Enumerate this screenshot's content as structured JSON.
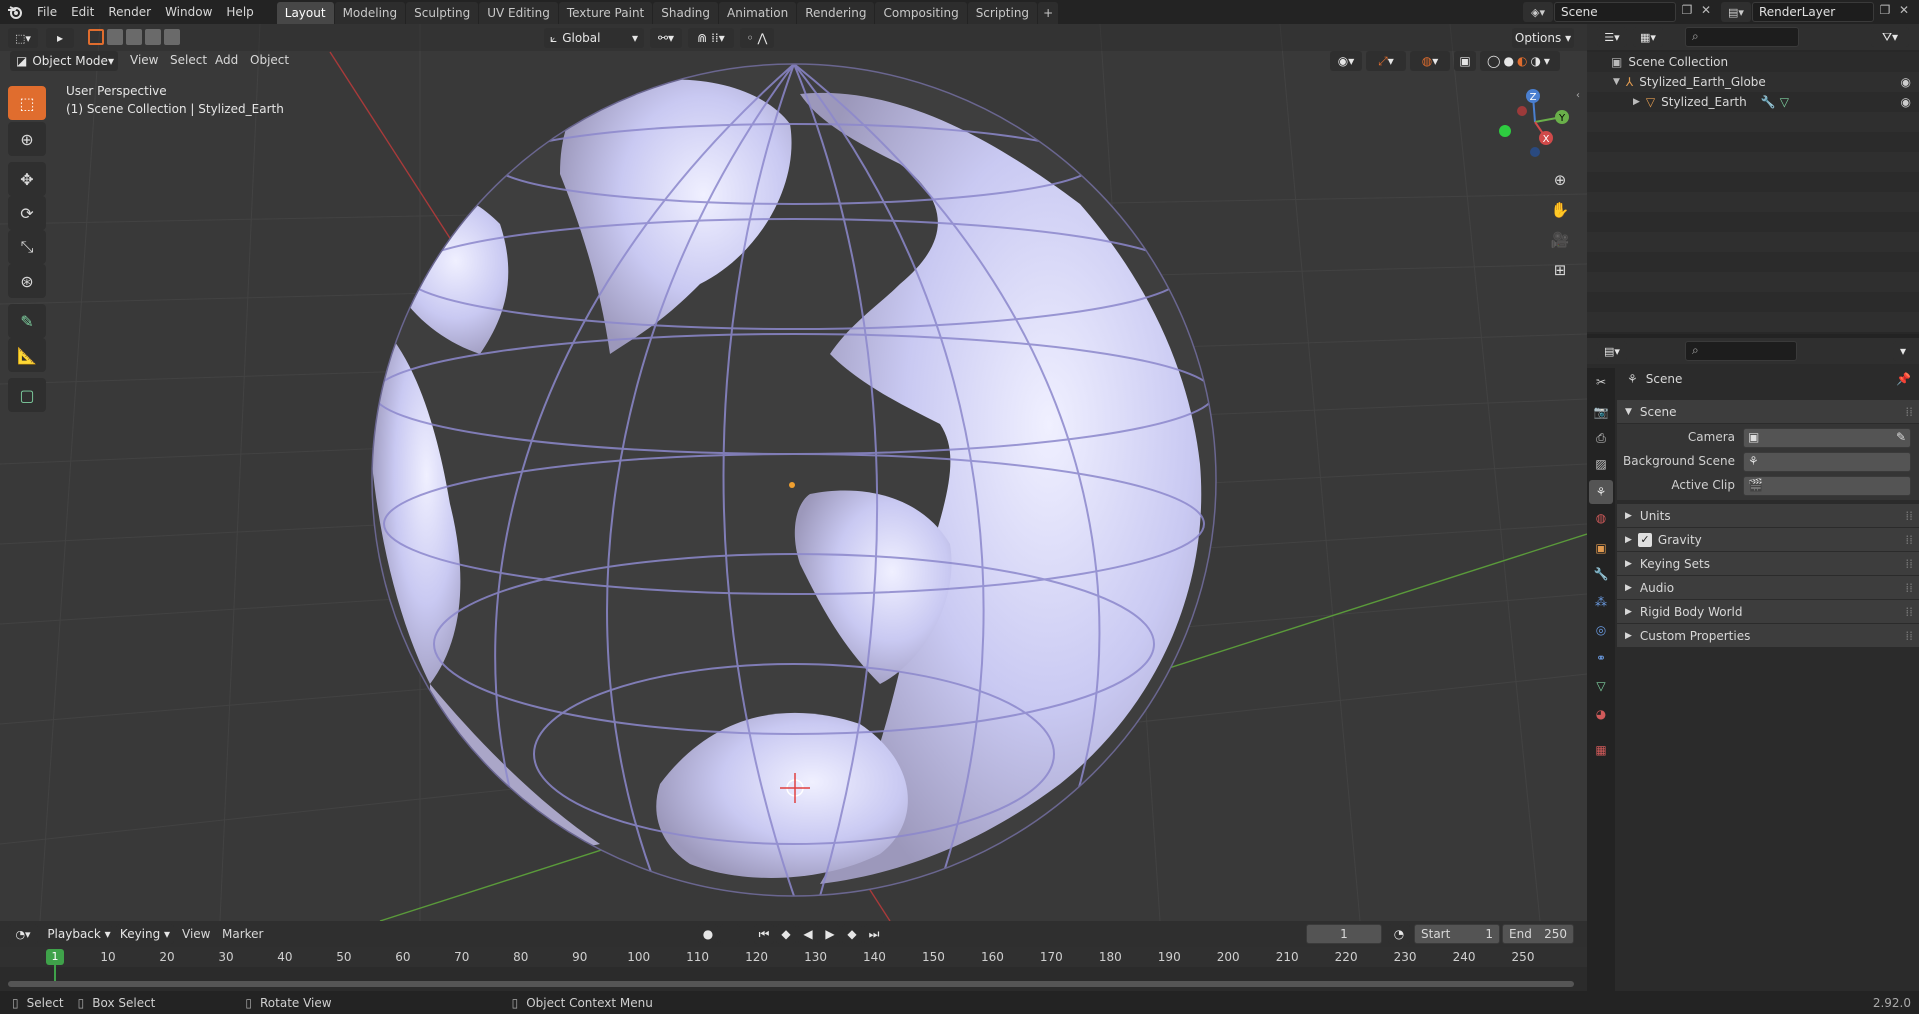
{
  "topbar": {
    "menus": [
      "File",
      "Edit",
      "Render",
      "Window",
      "Help"
    ],
    "workspaces": [
      "Layout",
      "Modeling",
      "Sculpting",
      "UV Editing",
      "Texture Paint",
      "Shading",
      "Animation",
      "Rendering",
      "Compositing",
      "Scripting"
    ],
    "active_workspace": "Layout",
    "add_tab": "+",
    "scene_name": "Scene",
    "view_layer": "RenderLayer"
  },
  "viewport": {
    "mode": "Object Mode",
    "menus": [
      "View",
      "Select",
      "Add",
      "Object"
    ],
    "orientation": "Global",
    "options": "Options",
    "perspective_label": "User Perspective",
    "context_label": "(1) Scene Collection | Stylized_Earth",
    "gizmo": {
      "x": "X",
      "y": "Y",
      "z": "Z"
    },
    "globe_color": "#b4b4ee",
    "accent": "#e06d2e"
  },
  "outliner": {
    "root": "Scene Collection",
    "items": [
      {
        "label": "Stylized_Earth_Globe"
      },
      {
        "label": "Stylized_Earth"
      }
    ]
  },
  "properties": {
    "context": "Scene",
    "section": "Scene",
    "fields": [
      {
        "label": "Camera",
        "value": ""
      },
      {
        "label": "Background Scene",
        "value": ""
      },
      {
        "label": "Active Clip",
        "value": ""
      }
    ],
    "panels": [
      {
        "label": "Units",
        "checkbox": false
      },
      {
        "label": "Gravity",
        "checkbox": true
      },
      {
        "label": "Keying Sets",
        "checkbox": false
      },
      {
        "label": "Audio",
        "checkbox": false
      },
      {
        "label": "Rigid Body World",
        "checkbox": false
      },
      {
        "label": "Custom Properties",
        "checkbox": false
      }
    ]
  },
  "timeline": {
    "menus": [
      "Playback",
      "Keying",
      "View",
      "Marker"
    ],
    "current_frame": "1",
    "start_label": "Start",
    "start": "1",
    "end_label": "End",
    "end": "250",
    "ticks": [
      "1",
      "10",
      "20",
      "30",
      "40",
      "50",
      "60",
      "70",
      "80",
      "90",
      "100",
      "110",
      "120",
      "130",
      "140",
      "150",
      "160",
      "170",
      "180",
      "190",
      "200",
      "210",
      "220",
      "230",
      "240",
      "250"
    ]
  },
  "statusbar": {
    "select": "Select",
    "box_select": "Box Select",
    "rotate_view": "Rotate View",
    "context_menu": "Object Context Menu",
    "version": "2.92.0"
  }
}
